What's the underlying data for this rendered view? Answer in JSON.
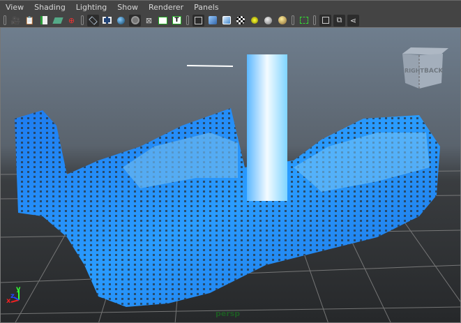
{
  "menubar": {
    "items": [
      "View",
      "Shading",
      "Lighting",
      "Show",
      "Renderer",
      "Panels"
    ]
  },
  "toolbar": {
    "icons": [
      "select-camera-icon",
      "camera-attributes-icon",
      "bookmark-icon",
      "image-plane-icon",
      "2d-pan-zoom-icon",
      "grid-icon",
      "film-gate-icon",
      "resolution-gate-icon",
      "gate-mask-icon",
      "field-chart-icon",
      "safe-action-icon",
      "safe-title-icon",
      "wireframe-icon",
      "smooth-shade-icon",
      "wireframe-on-shaded-icon",
      "textured-icon",
      "use-all-lights-icon",
      "shadows-icon",
      "ambient-occlusion-icon",
      "isolate-select-icon",
      "xray-icon",
      "xray-joints-icon",
      "xray-components-icon"
    ]
  },
  "viewport": {
    "camera_label": "persp",
    "view_cube": {
      "faces": [
        "RIGHT",
        "BACK"
      ]
    },
    "axis": {
      "x": "x",
      "y": "y",
      "z": "z"
    },
    "colors": {
      "fluid": "#1e8cff",
      "fluid_light": "#7fd4ff",
      "grid": "#8a8a8a"
    }
  }
}
